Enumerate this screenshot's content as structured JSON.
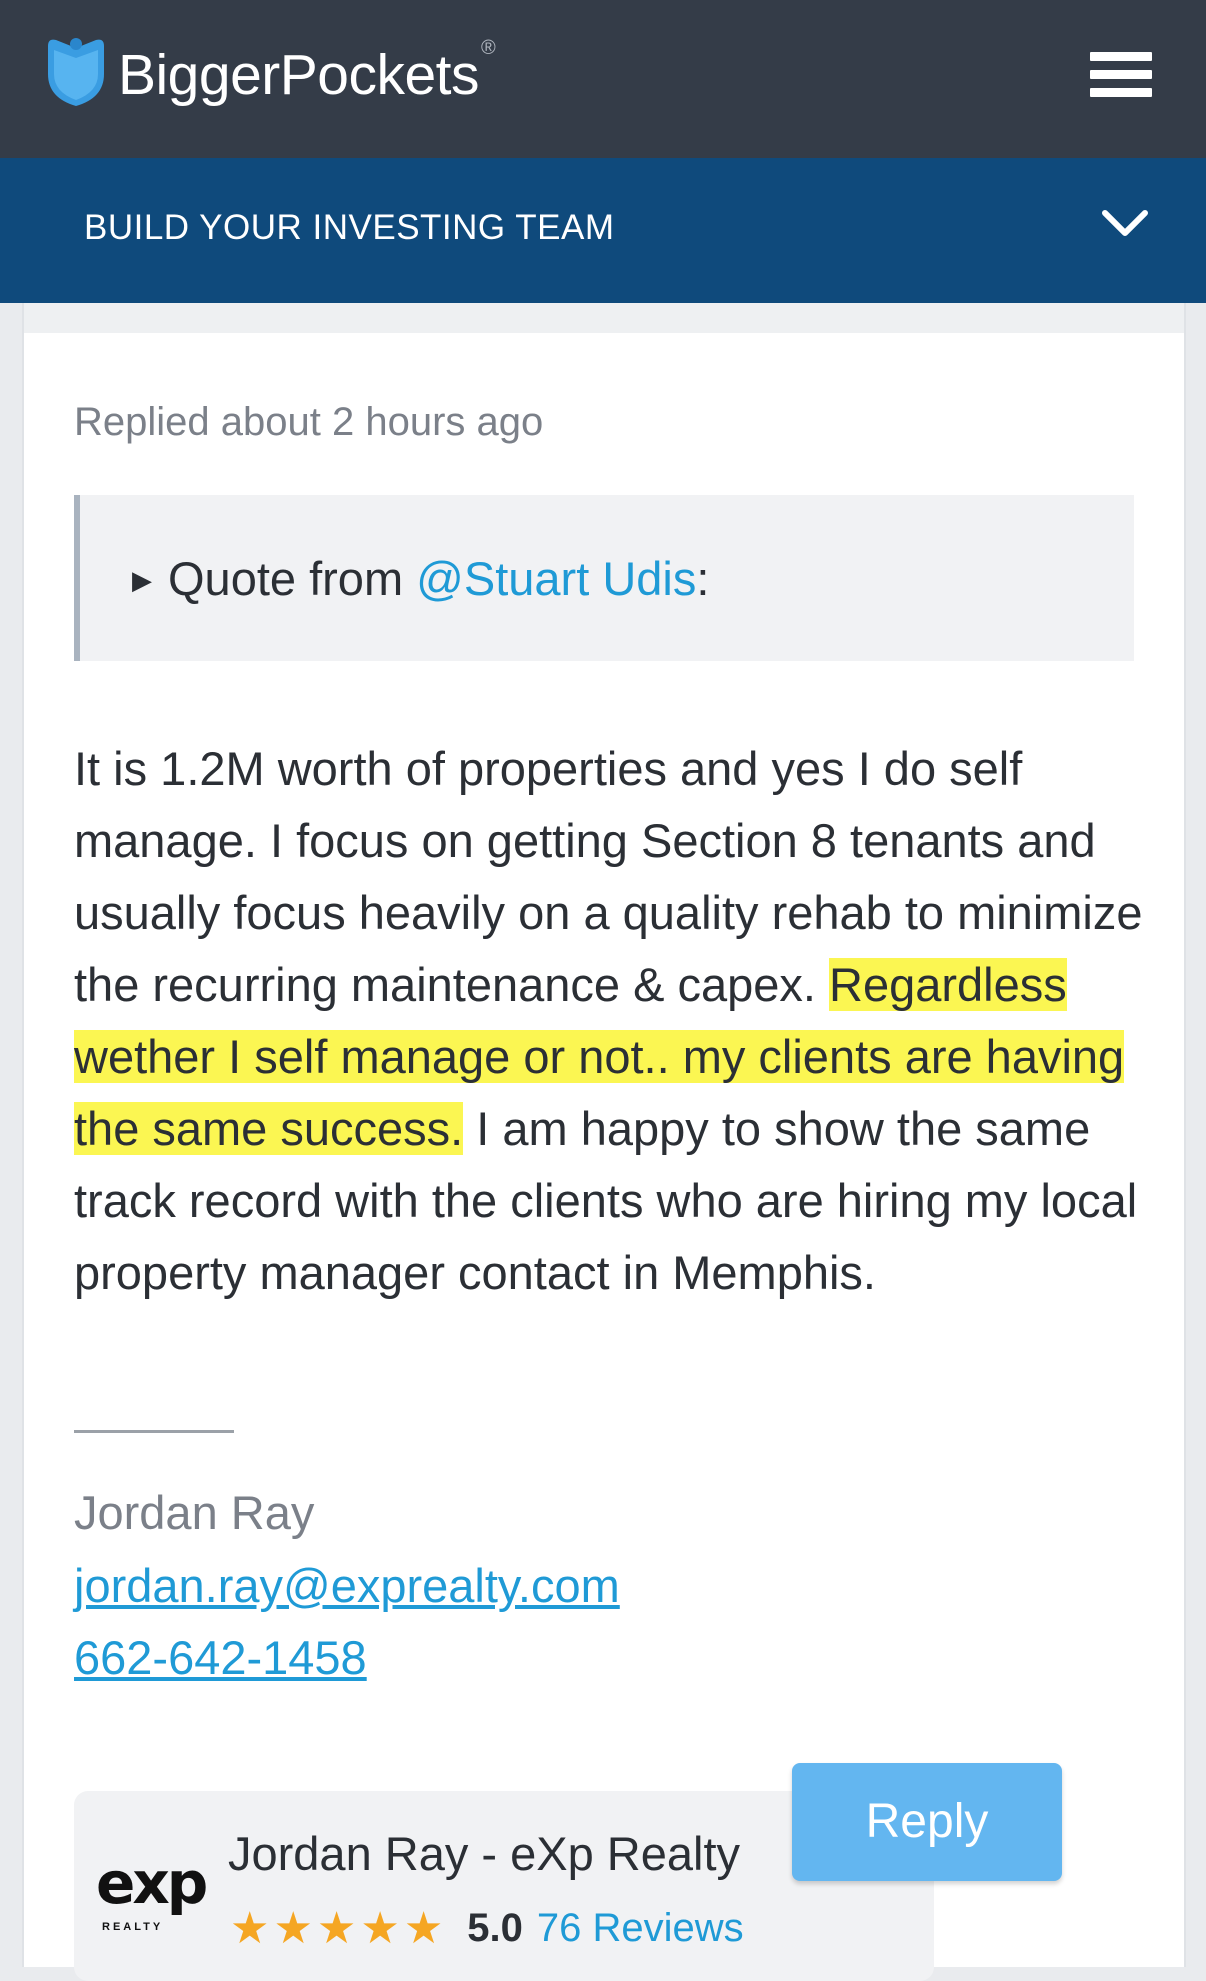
{
  "header": {
    "brand": "BiggerPockets",
    "registered": "®",
    "colors": {
      "background": "#343c48",
      "accent": "#1f9ad6"
    }
  },
  "nav": {
    "title": "BUILD YOUR INVESTING TEAM",
    "background": "#0f4a7c"
  },
  "post": {
    "replied": "Replied about 2 hours ago",
    "quote": {
      "prefix": "Quote from ",
      "mention": "@Stuart Udis",
      "suffix": ":"
    },
    "body": {
      "part1": "It is 1.2M worth of properties and yes I do self manage. I focus on getting Section 8 tenants and usually focus heavily on a quality rehab to minimize the recurring maintenance & capex. ",
      "highlight": "Regardless wether I self manage or not.. my clients are having the same success.",
      "part2": " I am happy to show the same track record with the clients who are hiring my local property manager contact in Memphis."
    },
    "signature": {
      "name": "Jordan Ray",
      "email": "jordan.ray@exprealty.com",
      "phone": "662-642-1458"
    }
  },
  "agent": {
    "logo_word": "exp",
    "logo_sub": "REALTY",
    "name": "Jordan Ray - eXp Realty",
    "stars": 5,
    "rating": "5.0",
    "reviews": "76 Reviews"
  },
  "actions": {
    "reply_label": "Reply"
  },
  "icons": {
    "logo": "bigger-pockets-logo-icon",
    "menu": "hamburger-menu-icon",
    "expand": "chevron-down-icon",
    "quote_toggle": "triangle-right-icon",
    "star": "star-icon"
  }
}
